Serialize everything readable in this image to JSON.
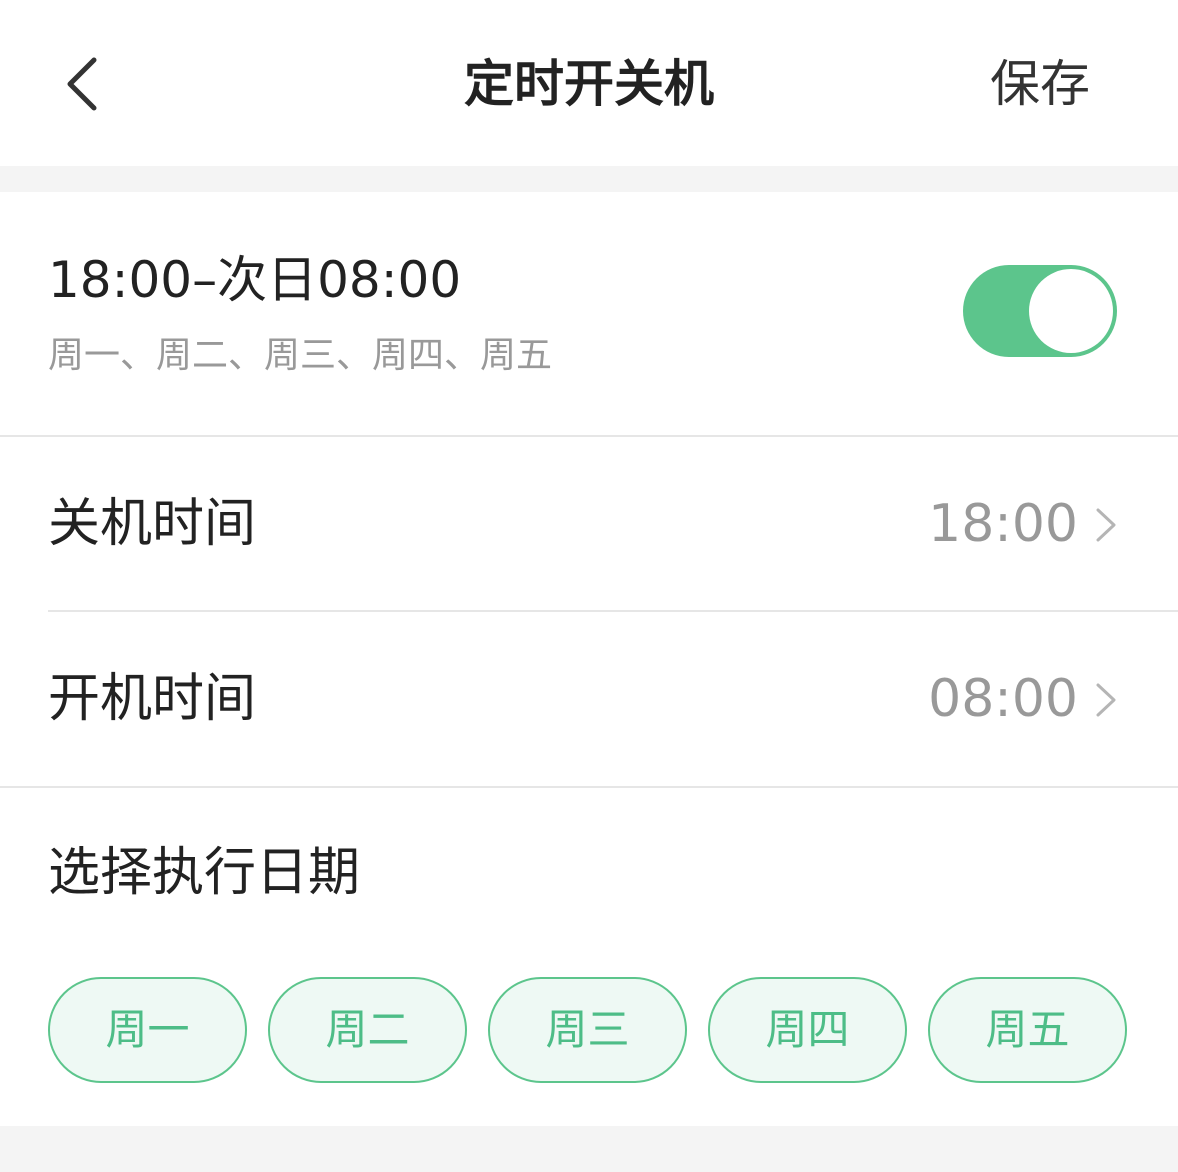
{
  "header": {
    "title": "定时开关机",
    "save_label": "保存",
    "back_icon": "chevron-left-icon"
  },
  "summary": {
    "time_range": "18:00–次日08:00",
    "days": "周一、周二、周三、周四、周五",
    "enabled": true,
    "toggle_color": "#5cc58c"
  },
  "shutdown": {
    "label": "关机时间",
    "value": "18:00"
  },
  "startup": {
    "label": "开机时间",
    "value": "08:00"
  },
  "schedule": {
    "title": "选择执行日期",
    "days": [
      {
        "label": "周一",
        "selected": true
      },
      {
        "label": "周二",
        "selected": true
      },
      {
        "label": "周三",
        "selected": true
      },
      {
        "label": "周四",
        "selected": true
      },
      {
        "label": "周五",
        "selected": true
      }
    ],
    "accent_color": "#5cc58c",
    "chip_background": "#eef9f4"
  }
}
